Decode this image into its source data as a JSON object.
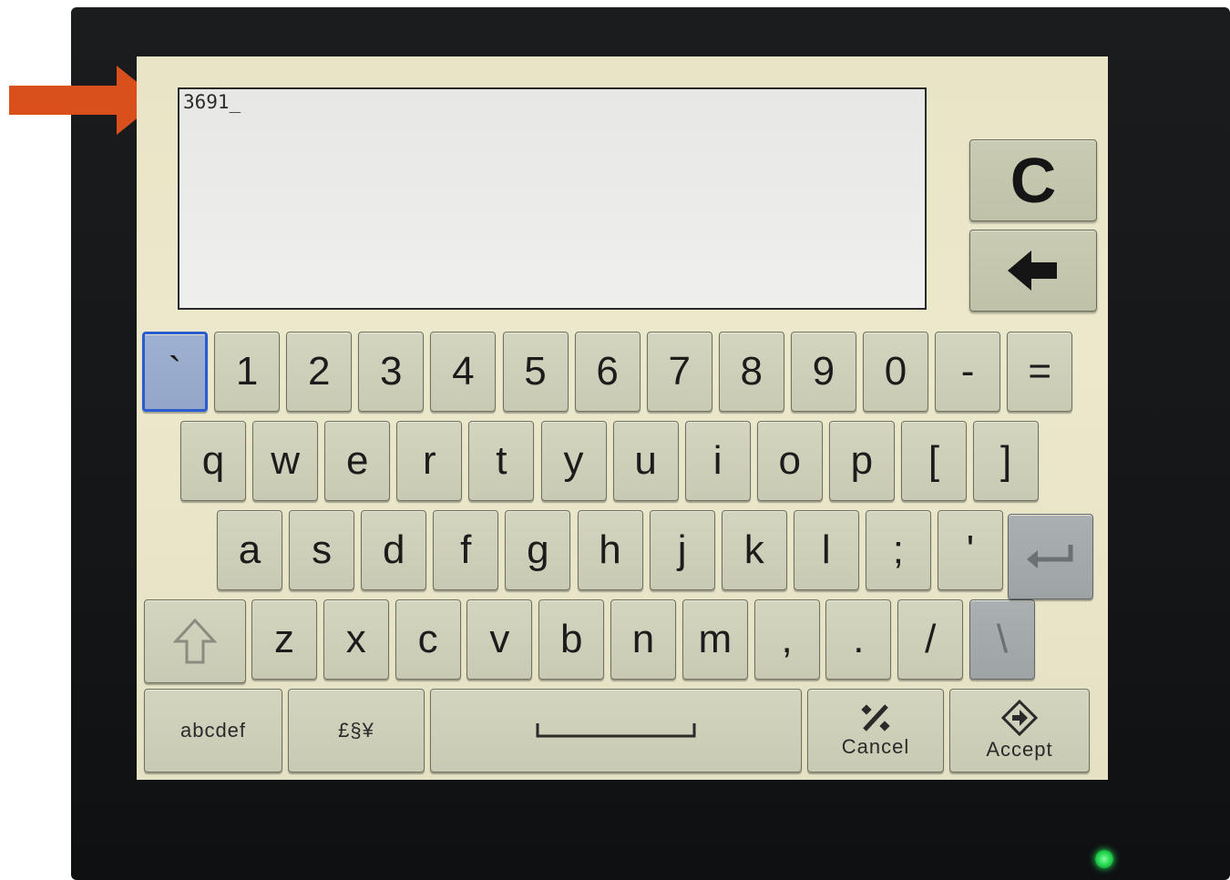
{
  "annotation": {
    "arrow_color": "#d9501c",
    "icon": "right-arrow-icon"
  },
  "input": {
    "value": "3691_"
  },
  "side_buttons": {
    "clear_label": "C",
    "backspace_icon": "left-arrow-icon"
  },
  "keyboard": {
    "row1": [
      "`",
      "1",
      "2",
      "3",
      "4",
      "5",
      "6",
      "7",
      "8",
      "9",
      "0",
      "-",
      "="
    ],
    "row2": [
      "q",
      "w",
      "e",
      "r",
      "t",
      "y",
      "u",
      "i",
      "o",
      "p",
      "[",
      "]"
    ],
    "row3": [
      "a",
      "s",
      "d",
      "f",
      "g",
      "h",
      "j",
      "k",
      "l",
      ";",
      "'"
    ],
    "row4": [
      "z",
      "x",
      "c",
      "v",
      "b",
      "n",
      "m",
      ",",
      ".",
      "/",
      "\\"
    ],
    "enter_icon": "enter-icon",
    "shift_icon": "shift-up-arrow-icon",
    "selected_key": "`"
  },
  "bottom": {
    "abc_label": "abcdef",
    "symbols_label": "£§¥",
    "space_icon": "space-bar-icon",
    "cancel_label": "Cancel",
    "cancel_icon": "percent-slash-icon",
    "accept_label": "Accept",
    "accept_icon": "diamond-arrow-icon"
  },
  "colors": {
    "key_bg": "#cfd0ba",
    "selected_key": "#2a5bd1",
    "screen_bg": "#ebe7ca",
    "status_led": "#1ed04a"
  }
}
